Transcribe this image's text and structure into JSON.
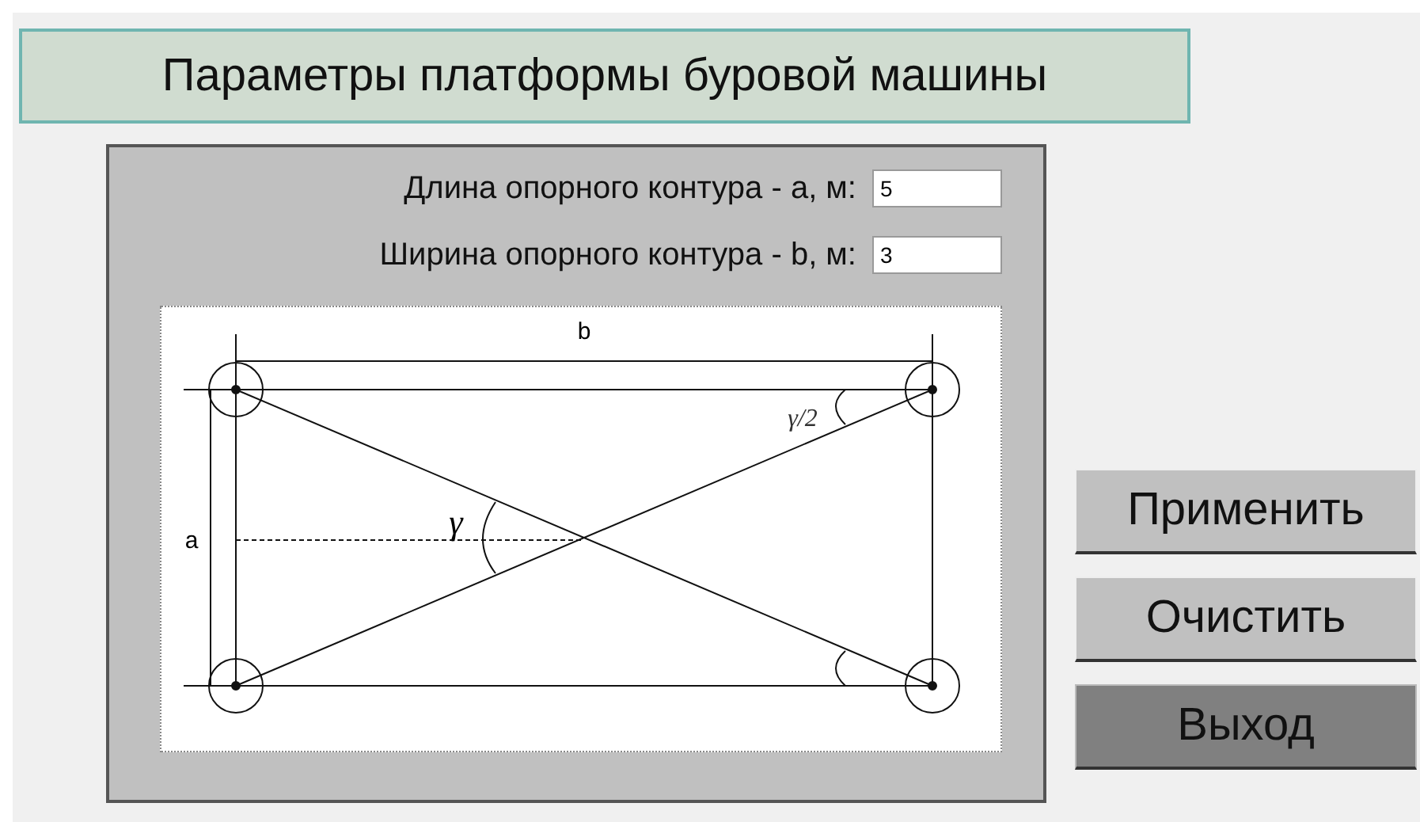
{
  "title": "Параметры платформы буровой машины",
  "fields": [
    {
      "label": "Длина опорного контура - a, м:",
      "value": "5"
    },
    {
      "label": "Ширина опорного контура - b, м:",
      "value": "3"
    }
  ],
  "diagram": {
    "width_label": "b",
    "height_label": "a",
    "angle_label": "γ",
    "half_angle_label": "γ/2"
  },
  "buttons": [
    {
      "label": "Применить",
      "pressed": false
    },
    {
      "label": "Очистить",
      "pressed": false
    },
    {
      "label": "Выход",
      "pressed": true
    }
  ]
}
